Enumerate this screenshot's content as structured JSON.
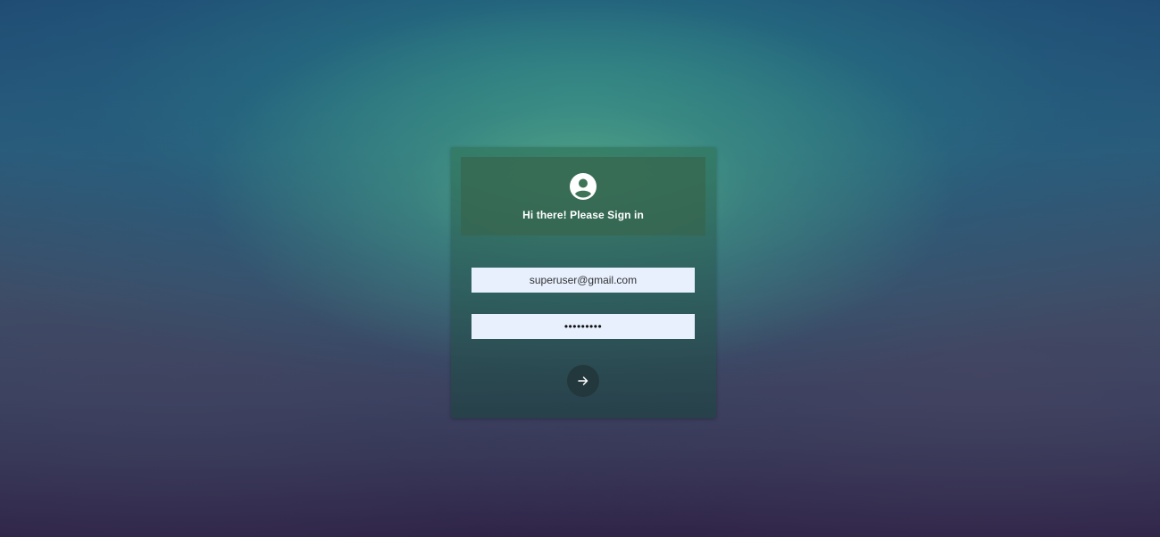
{
  "login_card": {
    "title": "Hi there! Please Sign in",
    "avatar_icon": "user-circle-icon",
    "email": {
      "value": "superuser@gmail.com"
    },
    "password": {
      "value": "superuser"
    },
    "submit_icon": "arrow-right-icon"
  },
  "colors": {
    "input_background": "#e8f0fe",
    "submit_button": "#23383c",
    "text_on_card": "#ffffff"
  }
}
